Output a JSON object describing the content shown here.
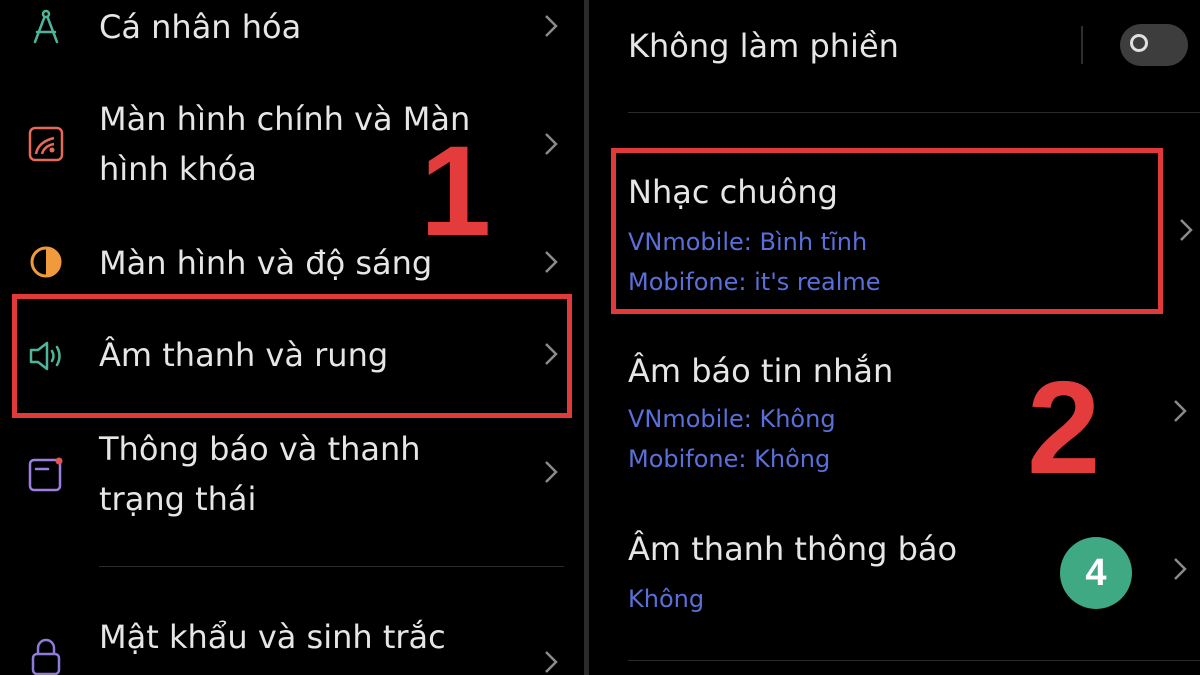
{
  "left_panel": {
    "items": [
      {
        "label_lines": [
          "Cá nhân hóa"
        ],
        "icon": "compass-personalize-icon"
      },
      {
        "label_lines": [
          "Màn hình chính và Màn",
          "hình khóa"
        ],
        "icon": "wallpaper-icon"
      },
      {
        "label_lines": [
          "Màn hình và độ sáng"
        ],
        "icon": "brightness-icon"
      },
      {
        "label_lines": [
          "Âm thanh và rung"
        ],
        "icon": "speaker-icon"
      },
      {
        "label_lines": [
          "Thông báo và thanh",
          "trạng thái"
        ],
        "icon": "notification-bar-icon"
      },
      {
        "label_lines": [
          "Mật khẩu và sinh trắc"
        ],
        "icon": "lock-icon"
      }
    ],
    "step_number": "1"
  },
  "right_panel": {
    "dnd": {
      "label": "Không làm phiền",
      "toggle_on": false
    },
    "ringtone": {
      "title": "Nhạc chuông",
      "sim1": "VNmobile: Bình tĩnh",
      "sim2": "Mobifone: it's realme"
    },
    "message_tone": {
      "title": "Âm báo tin nhắn",
      "sim1": "VNmobile: Không",
      "sim2": "Mobifone: Không"
    },
    "notification_sound": {
      "title": "Âm thanh thông báo",
      "value": "Không"
    },
    "step_number": "2",
    "badge": "4"
  },
  "colors": {
    "background": "#000000",
    "text": "#e6e6e6",
    "sub_text": "#5b6fd8",
    "highlight": "#e03a3a",
    "badge": "#3fa984"
  }
}
